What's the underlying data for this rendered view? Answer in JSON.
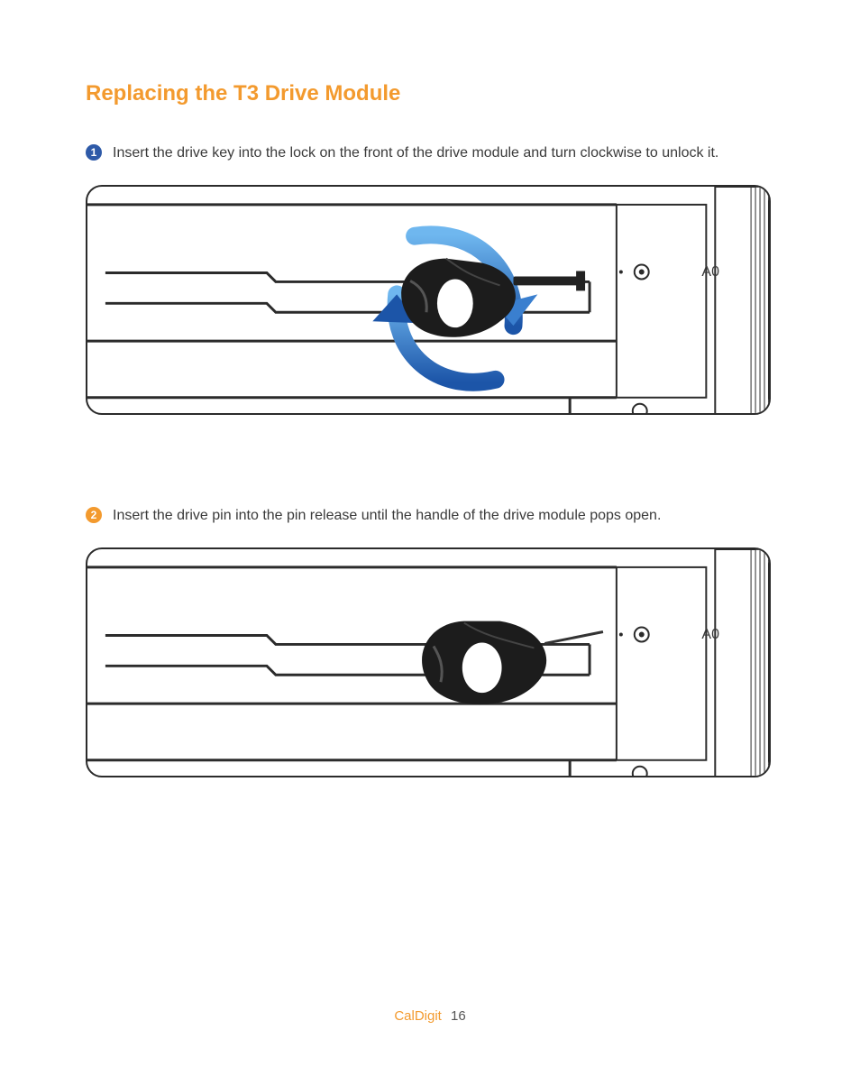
{
  "title": "Replacing the T3 Drive Module",
  "steps": [
    {
      "number": "1",
      "text": "Insert the drive key into the lock on the front of the drive module and turn clockwise to unlock it."
    },
    {
      "number": "2",
      "text": "Insert the drive pin into the pin release until the handle of the drive module pops open."
    }
  ],
  "drive_label": "A0",
  "footer": {
    "brand": "CalDigit",
    "page": "16"
  }
}
